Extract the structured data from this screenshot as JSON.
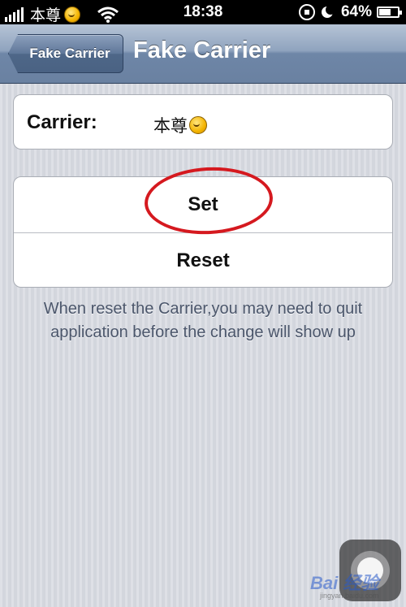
{
  "status_bar": {
    "carrier": "本尊",
    "time": "18:38",
    "battery_percent": "64%",
    "battery_level": 0.64,
    "icons": [
      "signal-icon",
      "emoji-icon",
      "wifi-icon",
      "rotation-lock-icon",
      "moon-icon",
      "battery-icon"
    ]
  },
  "nav": {
    "back_label": "Fake Carrier",
    "title": "Fake Carrier"
  },
  "carrier_field": {
    "label": "Carrier:",
    "value": "本尊"
  },
  "buttons": {
    "set_label": "Set",
    "reset_label": "Reset"
  },
  "note": "When reset the Carrier,you may need to quit application before the change will show up",
  "watermark": {
    "text": "Bai 经验",
    "url": "jingyan.baidu.com"
  },
  "colors": {
    "highlight": "#d5191f",
    "nav_bar": "#6e86a7"
  }
}
